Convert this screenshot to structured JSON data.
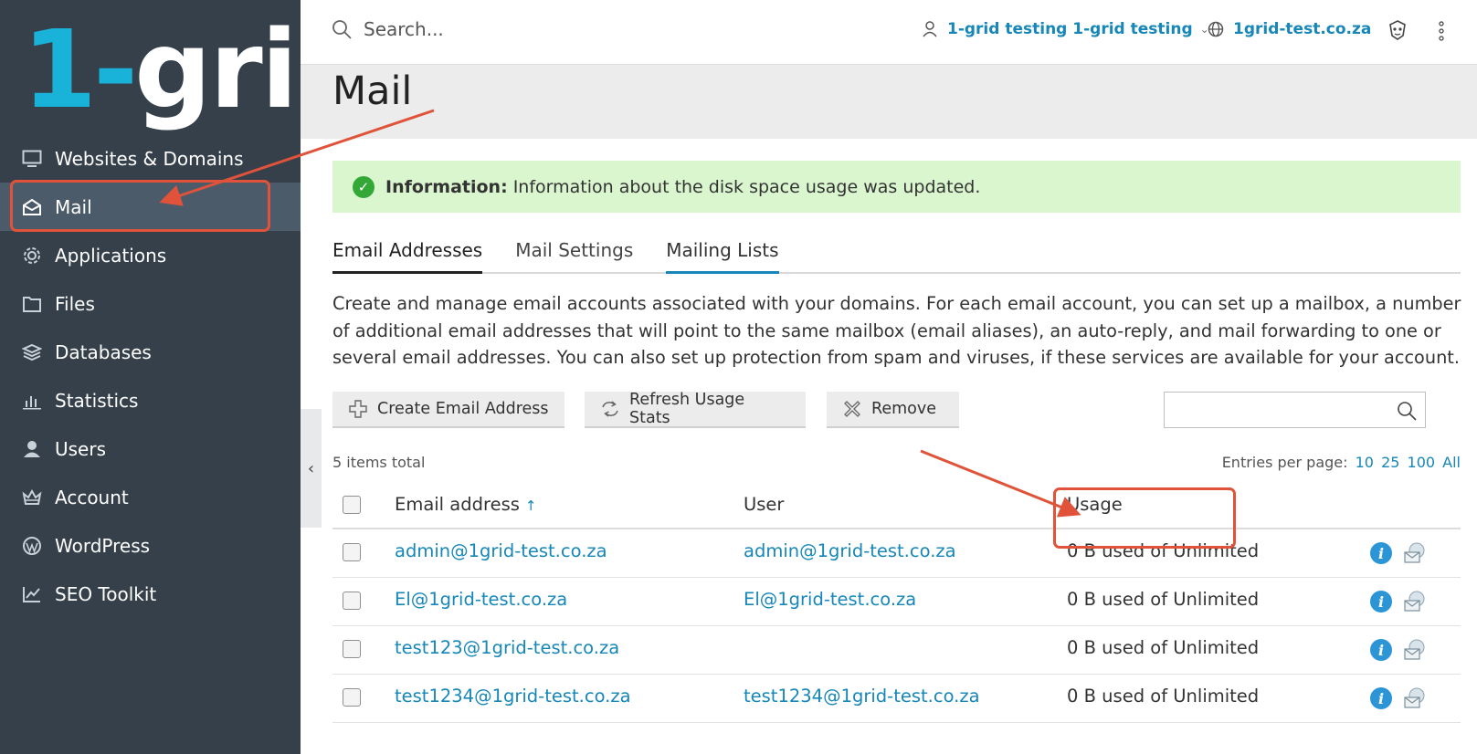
{
  "brand": {
    "logo_part1": "1-",
    "logo_part2": "grid"
  },
  "sidebar": {
    "items": [
      {
        "label": "Websites & Domains",
        "icon": "monitor-icon",
        "active": false
      },
      {
        "label": "Mail",
        "icon": "envelope-open-icon",
        "active": true
      },
      {
        "label": "Applications",
        "icon": "gear-icon",
        "active": false
      },
      {
        "label": "Files",
        "icon": "folder-icon",
        "active": false
      },
      {
        "label": "Databases",
        "icon": "layers-icon",
        "active": false
      },
      {
        "label": "Statistics",
        "icon": "bar-chart-icon",
        "active": false
      },
      {
        "label": "Users",
        "icon": "user-icon",
        "active": false
      },
      {
        "label": "Account",
        "icon": "crown-icon",
        "active": false
      },
      {
        "label": "WordPress",
        "icon": "wordpress-icon",
        "active": false
      },
      {
        "label": "SEO Toolkit",
        "icon": "trend-chart-icon",
        "active": false
      }
    ],
    "collapse_glyph": "‹"
  },
  "topbar": {
    "search_placeholder": "Search...",
    "user_label": "1-grid testing 1-grid testing",
    "domain_label": "1grid-test.co.za"
  },
  "page": {
    "title": "Mail"
  },
  "info_message": {
    "label": "Information:",
    "text": "Information about the disk space usage was updated."
  },
  "tabs": [
    {
      "label": "Email Addresses",
      "active": true
    },
    {
      "label": "Mail Settings",
      "active": false
    },
    {
      "label": "Mailing Lists",
      "active": false
    }
  ],
  "description": "Create and manage email accounts associated with your domains. For each email account, you can set up a mailbox, a number of additional email addresses that will point to the same mailbox (email aliases), an auto-reply, and mail forwarding to one or several email addresses. You can also set up protection from spam and viruses, if these services are available for your account.",
  "toolbar": {
    "create_label": "Create Email Address",
    "refresh_label": "Refresh Usage Stats",
    "remove_label": "Remove"
  },
  "list_meta": {
    "total": "5 items total",
    "per_page_label": "Entries per page:",
    "per_page_options": [
      "10",
      "25",
      "100",
      "All"
    ]
  },
  "table": {
    "headers": {
      "email": "Email address",
      "user": "User",
      "usage": "Usage",
      "sort_glyph": "↑"
    },
    "rows": [
      {
        "email": "admin@1grid-test.co.za",
        "user": "admin@1grid-test.co.za",
        "usage": "0 B used of Unlimited"
      },
      {
        "email": "El@1grid-test.co.za",
        "user": "El@1grid-test.co.za",
        "usage": "0 B used of Unlimited"
      },
      {
        "email": "test123@1grid-test.co.za",
        "user": "",
        "usage": "0 B used of Unlimited"
      },
      {
        "email": "test1234@1grid-test.co.za",
        "user": "test1234@1grid-test.co.za",
        "usage": "0 B used of Unlimited"
      }
    ],
    "info_glyph": "i"
  },
  "colors": {
    "sidebar_bg": "#35404b",
    "sidebar_active": "#4c5b69",
    "brand_blue": "#19b2d8",
    "link": "#1687b8",
    "info_bg": "#daf6cf",
    "annotation": "#e0533a"
  }
}
